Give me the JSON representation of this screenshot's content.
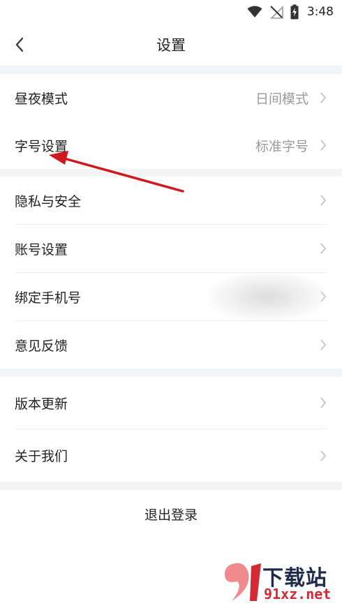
{
  "status_bar": {
    "time": "3:48",
    "icons": [
      "wifi-icon",
      "no-signal-icon",
      "battery-charging-icon"
    ]
  },
  "header": {
    "title": "设置",
    "back_icon": "chevron-left-icon"
  },
  "settings": {
    "group1": [
      {
        "label": "昼夜模式",
        "value": "日间模式"
      },
      {
        "label": "字号设置",
        "value": "标准字号"
      }
    ],
    "group2": [
      {
        "label": "隐私与安全"
      },
      {
        "label": "账号设置"
      },
      {
        "label": "绑定手机号"
      },
      {
        "label": "意见反馈"
      }
    ],
    "group3": [
      {
        "label": "版本更新"
      },
      {
        "label": "关于我们"
      }
    ]
  },
  "logout_label": "退出登录",
  "annotation": {
    "color": "#d0191f",
    "points_to": "字号设置"
  },
  "watermark": {
    "cn": "下载站",
    "url": "91xz.net",
    "logo": "91-logo"
  },
  "colors": {
    "background": "#ffffff",
    "separator": "#f3f4f6",
    "value_text": "#9a9a9a",
    "chevron": "#c4c4c4"
  }
}
